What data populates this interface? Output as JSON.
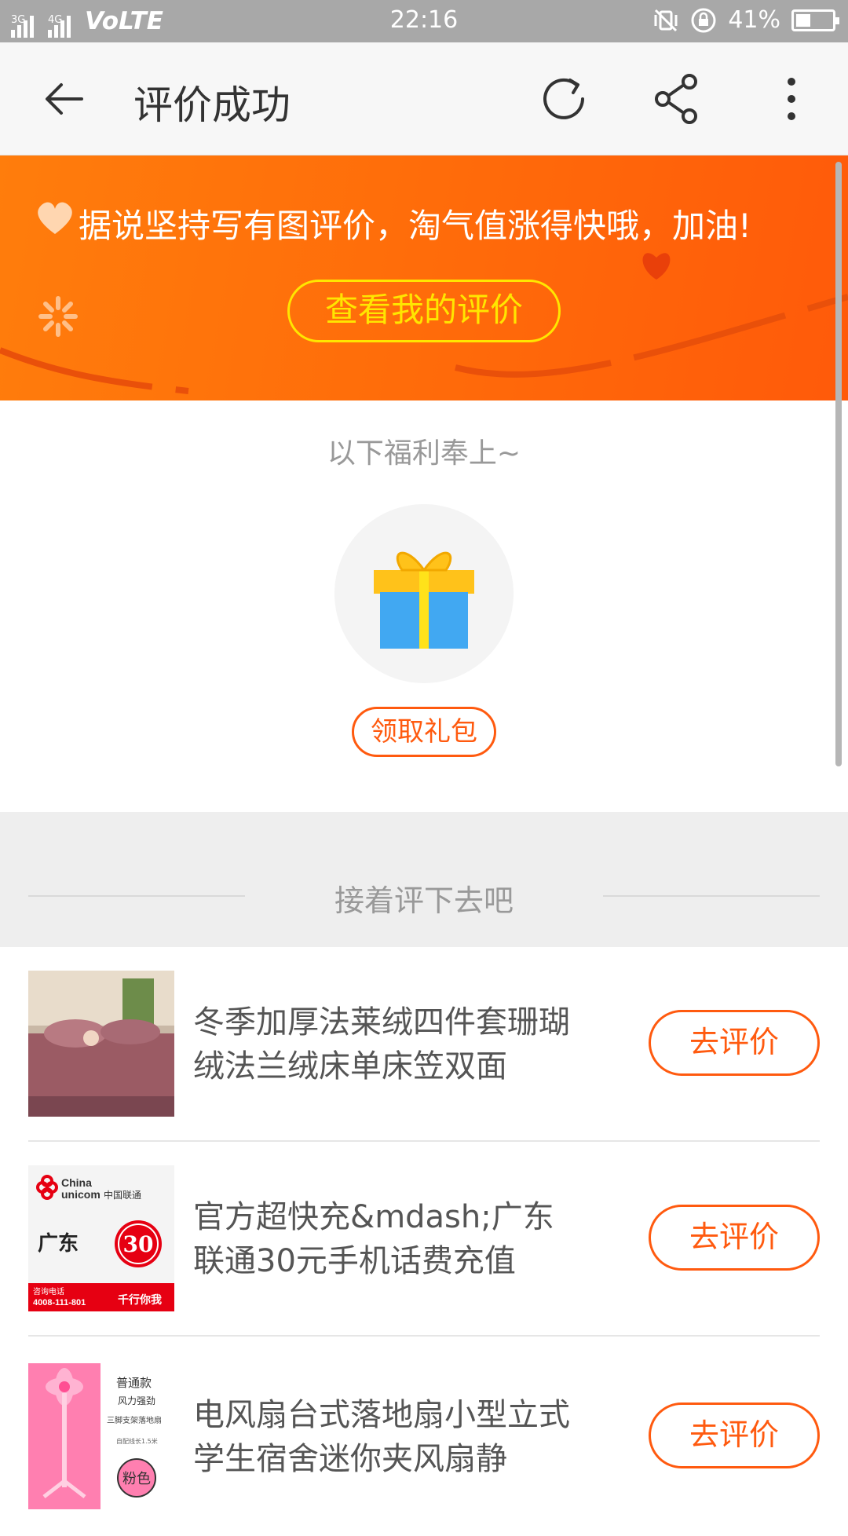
{
  "status_bar": {
    "network_left": "3G",
    "network_right": "4G",
    "volte": "VoLTE",
    "time": "22:16",
    "battery_percent": "41%",
    "battery_level": 0.41
  },
  "app_bar": {
    "title": "评价成功",
    "icons": [
      "back-arrow-icon",
      "refresh-icon",
      "share-icon",
      "more-icon"
    ]
  },
  "banner": {
    "message": "据说坚持写有图评价，淘气值涨得快哦，加油!",
    "view_button": "查看我的评价",
    "colors": {
      "start": "#ff7d0c",
      "end": "#ff5a0a",
      "button": "#ffe600"
    }
  },
  "benefit": {
    "title": "以下福利奉上~",
    "claim_button": "领取礼包"
  },
  "continue_section": {
    "title": "接着评下去吧"
  },
  "items": [
    {
      "name": "冬季加厚法莱绒四件套珊瑚绒法兰绒床单床笠双面",
      "button": "去评价"
    },
    {
      "name": "官方超快充&mdash;广东联通30元手机话费充值",
      "button": "去评价",
      "thumb": {
        "brand_en_1": "China",
        "brand_en_2": "unicom",
        "brand_cn": "中国联通",
        "region": "广东",
        "amount": "30",
        "phone_label": "咨询电话",
        "phone": "4008-111-801",
        "slogan": "千行你我"
      }
    },
    {
      "name": "电风扇台式落地扇小型立式学生宿舍迷你夹风扇静",
      "button": "去评价",
      "thumb": {
        "line1": "普通款",
        "line2": "风力强劲",
        "line3": "三脚支架落地扇",
        "line4": "自配线长1.5米",
        "badge": "粉色"
      }
    }
  ],
  "accent_color": "#ff5a0f"
}
